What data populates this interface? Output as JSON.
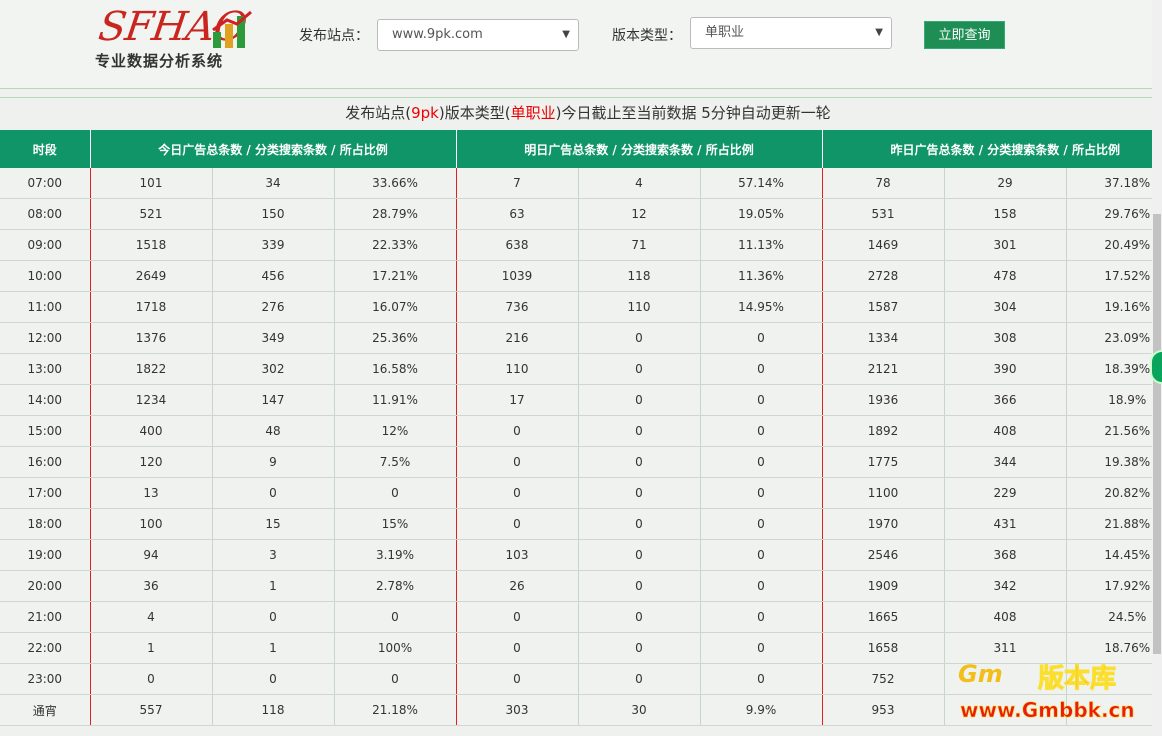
{
  "logo": {
    "text": "SFHAO",
    "subtitle": "专业数据分析系统"
  },
  "search": {
    "site_label": "发布站点：",
    "site_value": "www.9pk.com",
    "type_label": "版本类型：",
    "type_value": "单职业",
    "submit_label": "立即查询"
  },
  "notice": {
    "prefix": "发布站点(",
    "site": "9pk",
    "mid": ")版本类型(",
    "type": "单职业",
    "suffix": ")今日截止至当前数据 5分钟自动更新一轮"
  },
  "table": {
    "headers": [
      "时段",
      "今日广告总条数 / 分类搜索条数 / 所占比例",
      "明日广告总条数 / 分类搜索条数 / 所占比例",
      "昨日广告总条数 / 分类搜索条数 / 所占比例"
    ],
    "rows": [
      [
        "07:00",
        "101",
        "34",
        "33.66%",
        "7",
        "4",
        "57.14%",
        "78",
        "29",
        "37.18%"
      ],
      [
        "08:00",
        "521",
        "150",
        "28.79%",
        "63",
        "12",
        "19.05%",
        "531",
        "158",
        "29.76%"
      ],
      [
        "09:00",
        "1518",
        "339",
        "22.33%",
        "638",
        "71",
        "11.13%",
        "1469",
        "301",
        "20.49%"
      ],
      [
        "10:00",
        "2649",
        "456",
        "17.21%",
        "1039",
        "118",
        "11.36%",
        "2728",
        "478",
        "17.52%"
      ],
      [
        "11:00",
        "1718",
        "276",
        "16.07%",
        "736",
        "110",
        "14.95%",
        "1587",
        "304",
        "19.16%"
      ],
      [
        "12:00",
        "1376",
        "349",
        "25.36%",
        "216",
        "0",
        "0",
        "1334",
        "308",
        "23.09%"
      ],
      [
        "13:00",
        "1822",
        "302",
        "16.58%",
        "110",
        "0",
        "0",
        "2121",
        "390",
        "18.39%"
      ],
      [
        "14:00",
        "1234",
        "147",
        "11.91%",
        "17",
        "0",
        "0",
        "1936",
        "366",
        "18.9%"
      ],
      [
        "15:00",
        "400",
        "48",
        "12%",
        "0",
        "0",
        "0",
        "1892",
        "408",
        "21.56%"
      ],
      [
        "16:00",
        "120",
        "9",
        "7.5%",
        "0",
        "0",
        "0",
        "1775",
        "344",
        "19.38%"
      ],
      [
        "17:00",
        "13",
        "0",
        "0",
        "0",
        "0",
        "0",
        "1100",
        "229",
        "20.82%"
      ],
      [
        "18:00",
        "100",
        "15",
        "15%",
        "0",
        "0",
        "0",
        "1970",
        "431",
        "21.88%"
      ],
      [
        "19:00",
        "94",
        "3",
        "3.19%",
        "103",
        "0",
        "0",
        "2546",
        "368",
        "14.45%"
      ],
      [
        "20:00",
        "36",
        "1",
        "2.78%",
        "26",
        "0",
        "0",
        "1909",
        "342",
        "17.92%"
      ],
      [
        "21:00",
        "4",
        "0",
        "0",
        "0",
        "0",
        "0",
        "1665",
        "408",
        "24.5%"
      ],
      [
        "22:00",
        "1",
        "1",
        "100%",
        "0",
        "0",
        "0",
        "1658",
        "311",
        "18.76%"
      ],
      [
        "23:00",
        "0",
        "0",
        "0",
        "0",
        "0",
        "0",
        "752",
        "",
        ""
      ],
      [
        "通宵",
        "557",
        "118",
        "21.18%",
        "303",
        "30",
        "9.9%",
        "953",
        "",
        ""
      ]
    ]
  },
  "watermark": {
    "brand": "版本库",
    "url": "www.Gmbbk.cn",
    "flame": "Gm"
  },
  "colors": {
    "header_bg": "#0f9567",
    "accent_red": "#e00000",
    "button_bg": "#1e8e54"
  }
}
